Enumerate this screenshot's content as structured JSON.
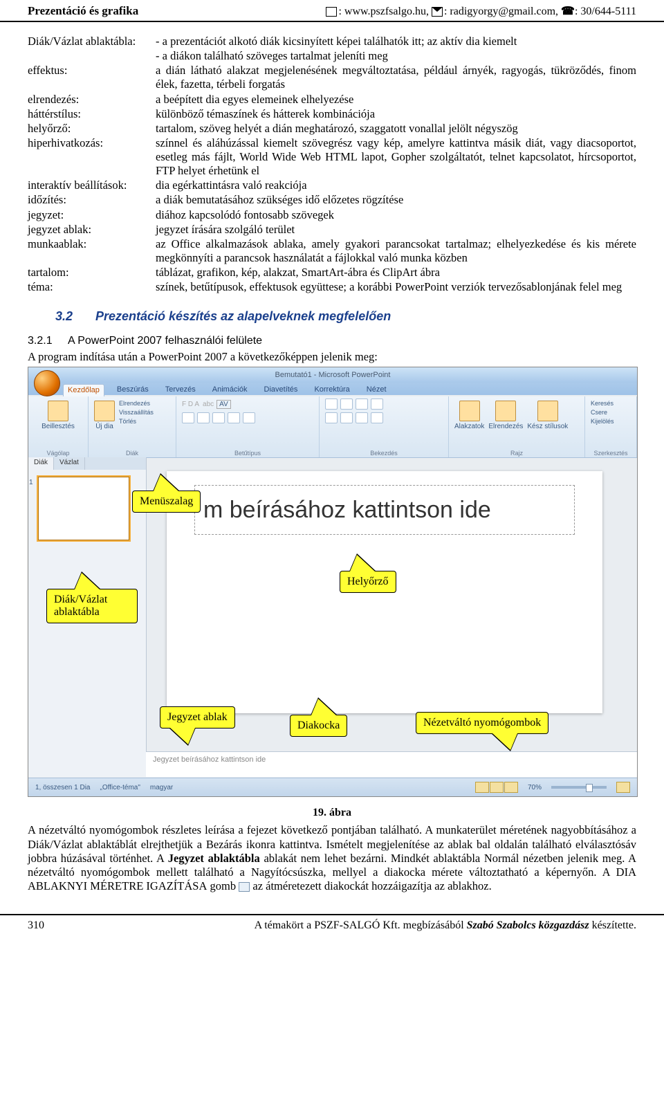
{
  "header": {
    "left": "Prezentáció és grafika",
    "url": ": www.pszfsalgo.hu, ",
    "email": ": radigyorgy@gmail.com, ",
    "phone": ": 30/644-5111"
  },
  "defs": [
    {
      "term": "Diák/Vázlat ablaktábla:",
      "desc": "- a prezentációt alkotó diák kicsinyített képei találhatók itt; az aktív dia kiemelt"
    },
    {
      "term": "",
      "desc": "- a diákon található szöveges tartalmat jeleníti meg"
    },
    {
      "term": "effektus:",
      "desc": "a dián látható alakzat megjelenésének megváltoztatása, például árnyék, ragyogás, tükröződés, finom élek, fazetta, térbeli forgatás"
    },
    {
      "term": "elrendezés:",
      "desc": "a beépített dia egyes elemeinek elhelyezése"
    },
    {
      "term": "háttérstílus:",
      "desc": "különböző témaszínek és hátterek kombinációja"
    },
    {
      "term": "helyőrző:",
      "desc": "tartalom, szöveg helyét a dián meghatározó, szaggatott vonallal jelölt négyszög"
    },
    {
      "term": "hiperhivatkozás:",
      "desc": "színnel és aláhúzással kiemelt szövegrész vagy kép, amelyre kattintva másik diát, vagy diacsoportot, esetleg más fájlt, World Wide Web HTML lapot, Gopher szolgáltatót, telnet kapcsolatot, hírcsoportot, FTP helyet érhetünk el"
    },
    {
      "term": "interaktív beállítások:",
      "desc": "dia egérkattintásra való reakciója"
    },
    {
      "term": "időzítés:",
      "desc": "a diák bemutatásához szükséges idő előzetes rögzítése"
    },
    {
      "term": "jegyzet:",
      "desc": "diához kapcsolódó fontosabb szövegek"
    },
    {
      "term": "jegyzet ablak:",
      "desc": "jegyzet írására szolgáló terület"
    },
    {
      "term": "munkaablak:",
      "desc": "az Office alkalmazások ablaka, amely gyakori parancsokat tartalmaz; elhelyezkedése és kis mérete megkönnyíti a parancsok használatát a fájlokkal való munka közben"
    },
    {
      "term": "tartalom:",
      "desc": "táblázat, grafikon, kép, alakzat, SmartArt-ábra és ClipArt ábra"
    },
    {
      "term": "téma:",
      "desc": "színek, betűtípusok, effektusok együttese; a korábbi PowerPoint verziók tervezősablonjának felel meg"
    }
  ],
  "section32": {
    "num": "3.2",
    "title": "Prezentáció készítés az alapelveknek megfelelően"
  },
  "section321": {
    "num": "3.2.1",
    "title": "A PowerPoint 2007 felhasználói felülete"
  },
  "introLine": "A program indítása után a PowerPoint 2007 a következőképpen jelenik meg:",
  "ppt": {
    "title": "Bemutató1 - Microsoft PowerPoint",
    "tabs": [
      "Kezdőlap",
      "Beszúrás",
      "Tervezés",
      "Animációk",
      "Diavetítés",
      "Korrektúra",
      "Nézet"
    ],
    "ribbonGroups": [
      "Vágólap",
      "Diák",
      "Betűtípus",
      "Bekezdés",
      "Rajz",
      "Szerkesztés"
    ],
    "ribbonItems": {
      "paste": "Beillesztés",
      "newSlide": "Új dia",
      "layout": "Elrendezés",
      "reset": "Visszaállítás",
      "delete": "Törlés",
      "shapes": "Alakzatok",
      "arrange": "Elrendezés",
      "quickStyles": "Kész stílusok",
      "find": "Keresés",
      "replace": "Csere",
      "select": "Kijelölés"
    },
    "sideTabs": [
      "Diák",
      "Vázlat"
    ],
    "thumbNum": "1",
    "slideTitlePlaceholder": "m beírásához kattintson ide",
    "notesPlaceholder": "Jegyzet beírásához kattintson ide",
    "status": {
      "slideInfo": "1, összesen 1 Dia",
      "theme": "„Office-téma\"",
      "lang": "magyar",
      "zoom": "70%"
    }
  },
  "callouts": {
    "menuszalag": "Menüszalag",
    "diakVazlat": "Diák/Vázlat ablaktábla",
    "helyorzo": "Helyőrző",
    "jegyzetAblak": "Jegyzet ablak",
    "diakocka": "Diakocka",
    "nezetvalto": "Nézetváltó nyomógombok"
  },
  "figCaption": "19. ábra",
  "para1a": "A nézetváltó nyomógombok részletes leírása a fejezet következő pontjában található. A munkaterület méretének nagyobbításához a Diák/Vázlat ablaktáblát elrejthetjük a Bezárás ikonra kattintva. Ismételt megjelenítése az ablak bal oldalán található elválasztósáv jobbra húzásával történhet. A ",
  "para1b": "Jegyzet ablaktábla",
  "para1c": " ablakát nem lehet bezárni. Mindkét ablaktábla Normál nézetben jelenik meg. A nézetváltó nyomógombok mellett található a Nagyítócsúszka, mellyel a diakocka mérete változtatható a képernyőn. A ",
  "para1d": "DIA ABLAKNYI MÉRETRE IGAZÍTÁSA",
  "para1e": " gomb ",
  "para1f": " az átméretezett diakockát hozzáigazítja az ablakhoz.",
  "footer": {
    "pageNum": "310",
    "text1": "A témakört a PSZF-SALGÓ Kft. megbízásából ",
    "author": "Szabó Szabolcs közgazdász",
    "text2": " készítette."
  }
}
